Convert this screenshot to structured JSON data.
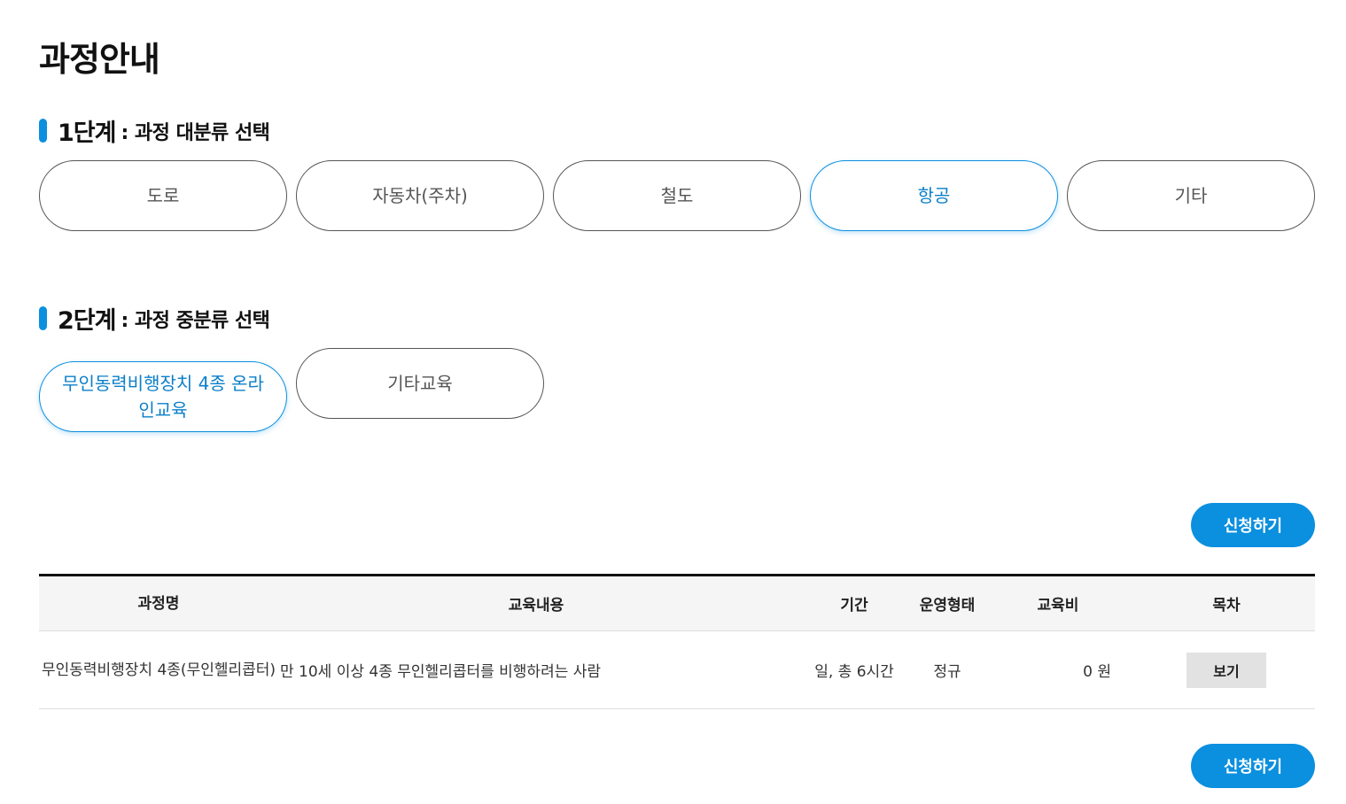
{
  "page": {
    "title": "과정안내"
  },
  "step1": {
    "number": "1단계",
    "label": ": 과정 대분류 선택",
    "options": [
      "도로",
      "자동차(주차)",
      "철도",
      "항공",
      "기타"
    ],
    "selected": "항공"
  },
  "step2": {
    "number": "2단계",
    "label": ": 과정 중분류 선택",
    "options": [
      "무인동력비행장치 4종 온라인교육",
      "기타교육"
    ],
    "selected": "무인동력비행장치 4종 온라인교육"
  },
  "actions": {
    "apply_label": "신청하기"
  },
  "table": {
    "headers": {
      "name": "과정명",
      "content": "교육내용",
      "period": "기간",
      "type": "운영형태",
      "fee": "교육비",
      "toc": "목차"
    },
    "rows": [
      {
        "name": "무인동력비행장치 4종(무인헬리콥터)",
        "content": "만 10세 이상 4종 무인헬리콥터를 비행하려는 사람",
        "period": "일, 총 6시간",
        "type": "정규",
        "fee": "0 원",
        "toc_button": "보기"
      }
    ]
  },
  "colors": {
    "accent": "#0b8fdf",
    "active_text": "#0b7fc9",
    "view_button_bg": "#e2e2e2"
  }
}
